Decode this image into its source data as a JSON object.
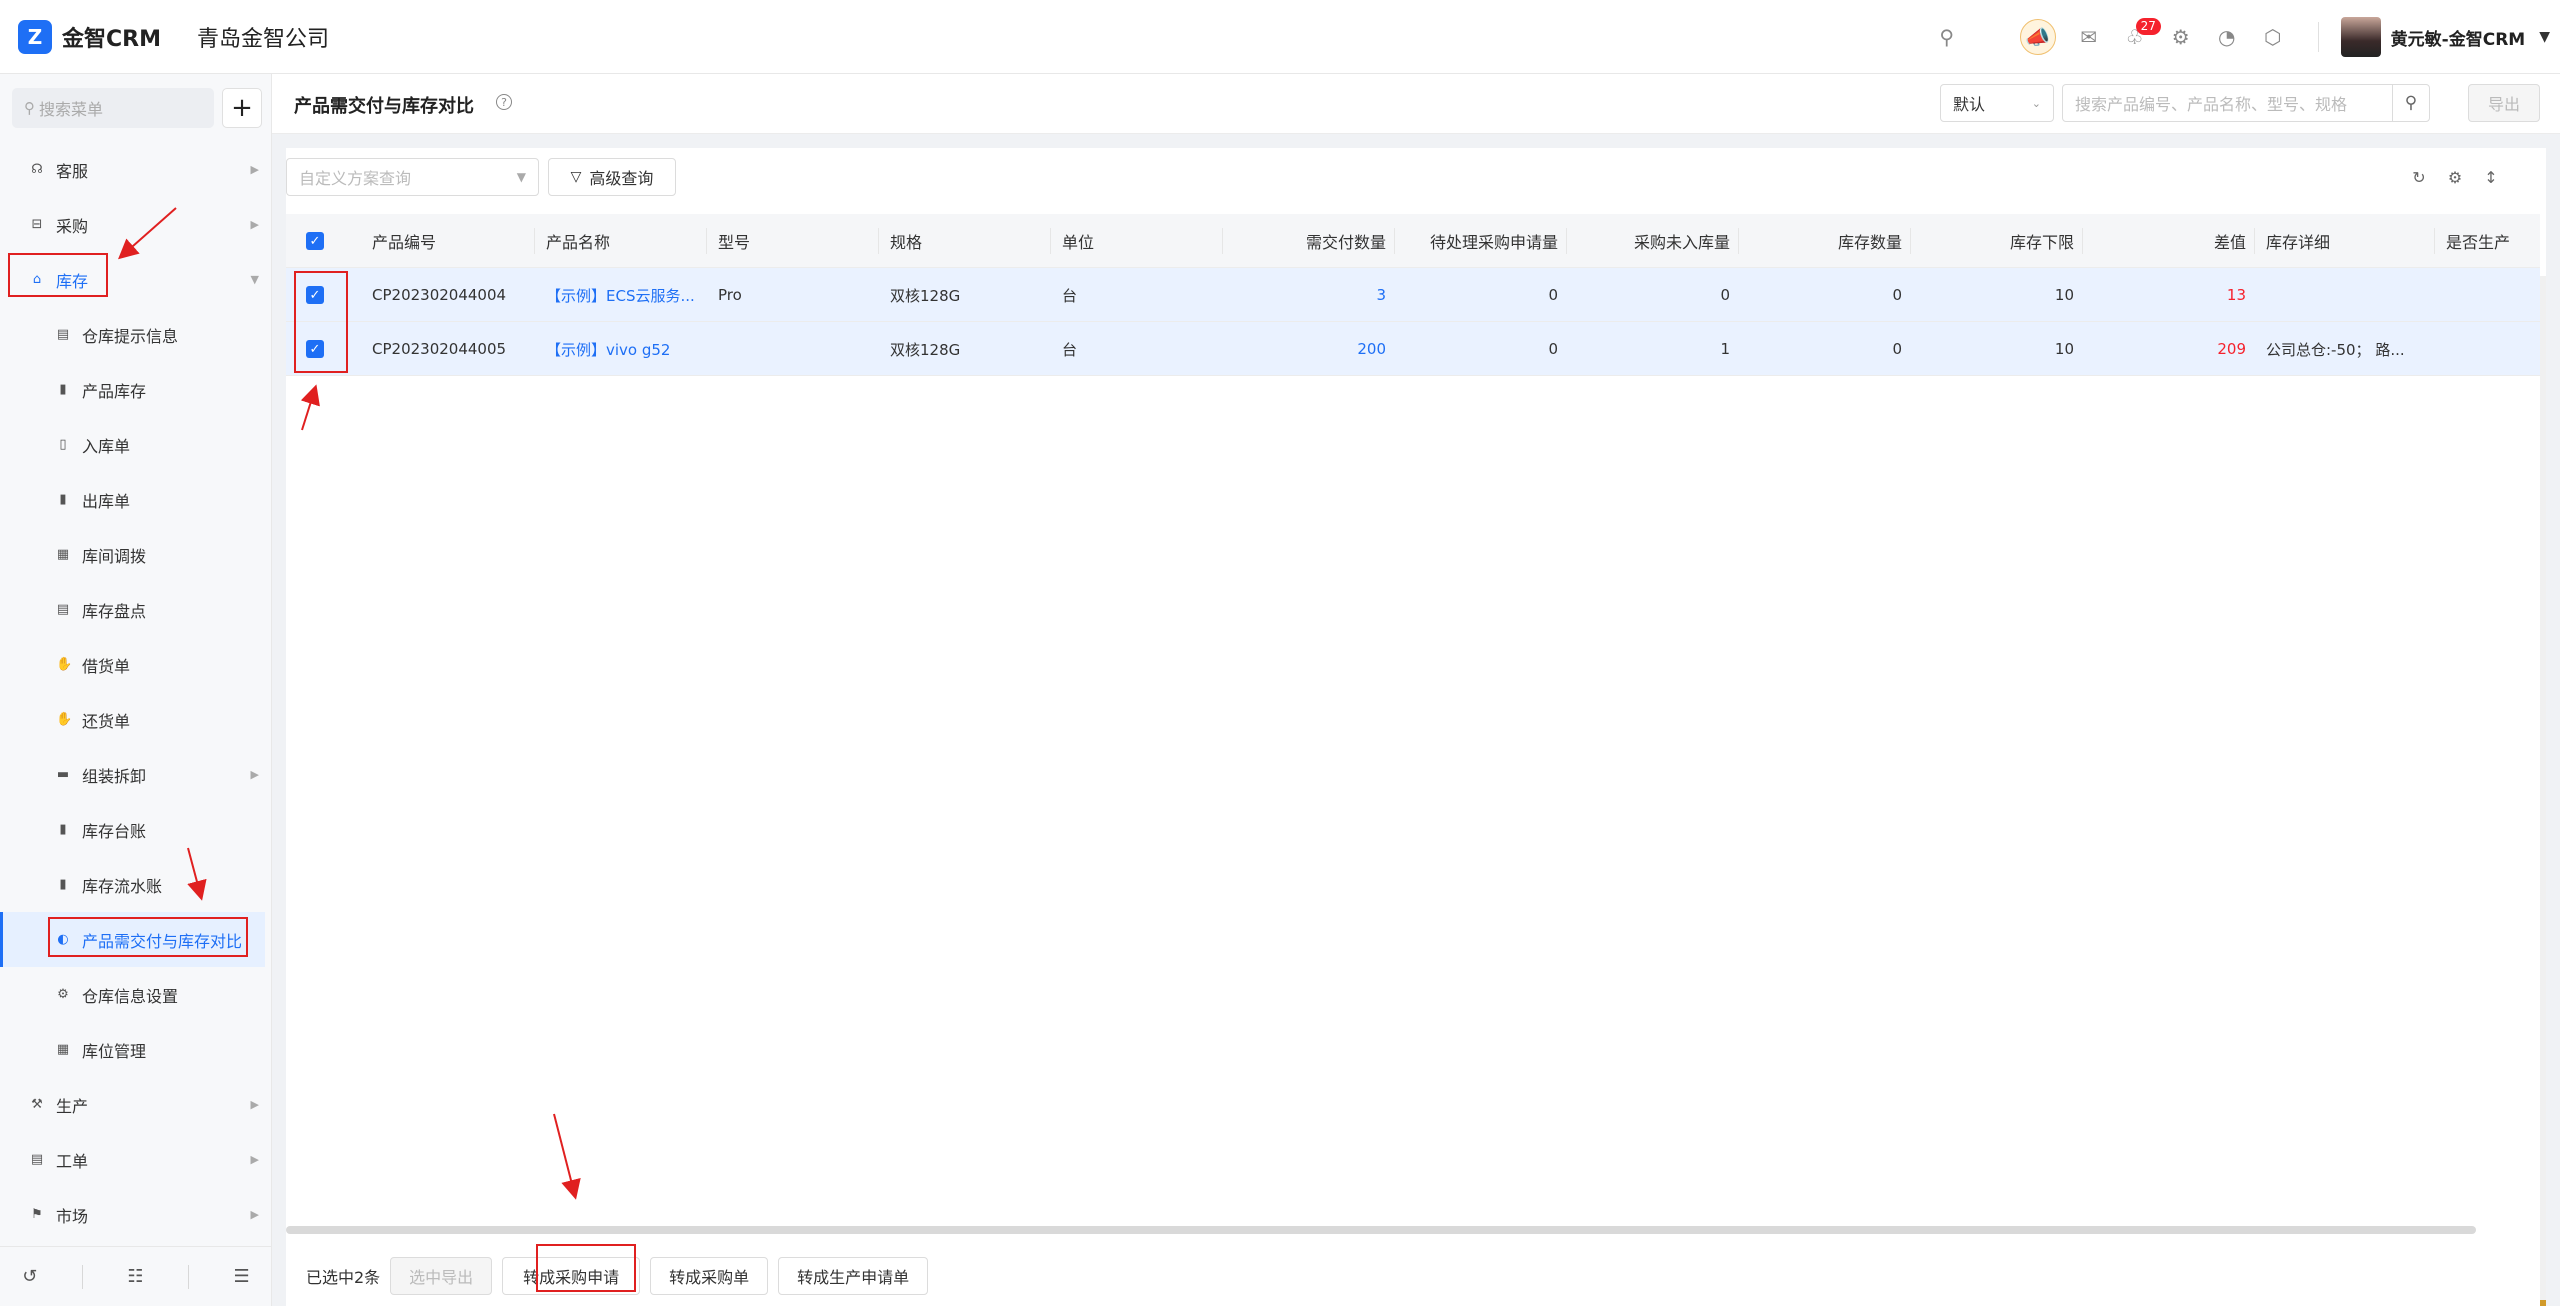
{
  "header": {
    "logo_mark": "Z",
    "logo_text": "金智CRM",
    "company": "青岛金智公司",
    "notification_count": "27",
    "user_name": "黄元敏-金智CRM"
  },
  "sidebar": {
    "search_placeholder": "搜索菜单",
    "items": [
      {
        "label": "客服",
        "icon": "headset-icon",
        "glyph": "☊",
        "level": "top",
        "arrow": "▶"
      },
      {
        "label": "采购",
        "icon": "cart-icon",
        "glyph": "⊟",
        "level": "top",
        "arrow": "▶"
      },
      {
        "label": "库存",
        "icon": "warehouse-icon",
        "glyph": "⌂",
        "level": "top",
        "arrow": "▼",
        "state": "open"
      },
      {
        "label": "仓库提示信息",
        "icon": "notice-icon",
        "glyph": "▤",
        "level": "sub"
      },
      {
        "label": "产品库存",
        "icon": "doc-icon",
        "glyph": "▮",
        "level": "sub"
      },
      {
        "label": "入库单",
        "icon": "inbound-icon",
        "glyph": "▯",
        "level": "sub"
      },
      {
        "label": "出库单",
        "icon": "outbound-icon",
        "glyph": "▮",
        "level": "sub"
      },
      {
        "label": "库间调拨",
        "icon": "transfer-icon",
        "glyph": "▦",
        "level": "sub"
      },
      {
        "label": "库存盘点",
        "icon": "inventory-icon",
        "glyph": "▤",
        "level": "sub"
      },
      {
        "label": "借货单",
        "icon": "borrow-icon",
        "glyph": "✋",
        "level": "sub"
      },
      {
        "label": "还货单",
        "icon": "return-icon",
        "glyph": "✋",
        "level": "sub"
      },
      {
        "label": "组装拆卸",
        "icon": "folder-icon",
        "glyph": "▬",
        "level": "sub",
        "arrow": "▶"
      },
      {
        "label": "库存台账",
        "icon": "ledger-icon",
        "glyph": "▮",
        "level": "sub"
      },
      {
        "label": "库存流水账",
        "icon": "journal-icon",
        "glyph": "▮",
        "level": "sub"
      },
      {
        "label": "产品需交付与库存对比",
        "icon": "compare-icon",
        "glyph": "◐",
        "level": "sub",
        "state": "selected"
      },
      {
        "label": "仓库信息设置",
        "icon": "gear-icon",
        "glyph": "⚙",
        "level": "sub"
      },
      {
        "label": "库位管理",
        "icon": "grid-icon",
        "glyph": "▦",
        "level": "sub"
      },
      {
        "label": "生产",
        "icon": "production-icon",
        "glyph": "⚒",
        "level": "top",
        "arrow": "▶"
      },
      {
        "label": "工单",
        "icon": "workorder-icon",
        "glyph": "▤",
        "level": "top",
        "arrow": "▶"
      },
      {
        "label": "市场",
        "icon": "flag-icon",
        "glyph": "⚑",
        "level": "top",
        "arrow": "▶"
      }
    ]
  },
  "main": {
    "title": "产品需交付与库存对比",
    "view_select": "默认",
    "search_placeholder": "搜索产品编号、产品名称、型号、规格",
    "export_label": "导出",
    "filter_placeholder": "自定义方案查询",
    "advanced_label": "高级查询"
  },
  "table": {
    "columns": [
      "产品编号",
      "产品名称",
      "型号",
      "规格",
      "单位",
      "需交付数量",
      "待处理采购申请量",
      "采购未入库量",
      "库存数量",
      "库存下限",
      "差值",
      "库存详细",
      "是否生产"
    ],
    "rows": [
      [
        "CP202302044004",
        "【示例】ECS云服务...",
        "Pro",
        "双核128G",
        "台",
        "3",
        "0",
        "0",
        "0",
        "10",
        "13",
        "",
        ""
      ],
      [
        "CP202302044005",
        "【示例】vivo g52",
        "",
        "双核128G",
        "台",
        "200",
        "0",
        "1",
        "0",
        "10",
        "209",
        "公司总仓:-50；  路...",
        ""
      ]
    ]
  },
  "bottom": {
    "selected_count": "已选中2条",
    "export_selected": "选中导出",
    "to_purchase_request": "转成采购申请",
    "to_purchase_order": "转成采购单",
    "to_production_request": "转成生产申请单"
  },
  "colors": {
    "accent": "#1e6ff5",
    "annotation": "#e02020",
    "negative": "#f5222d"
  }
}
